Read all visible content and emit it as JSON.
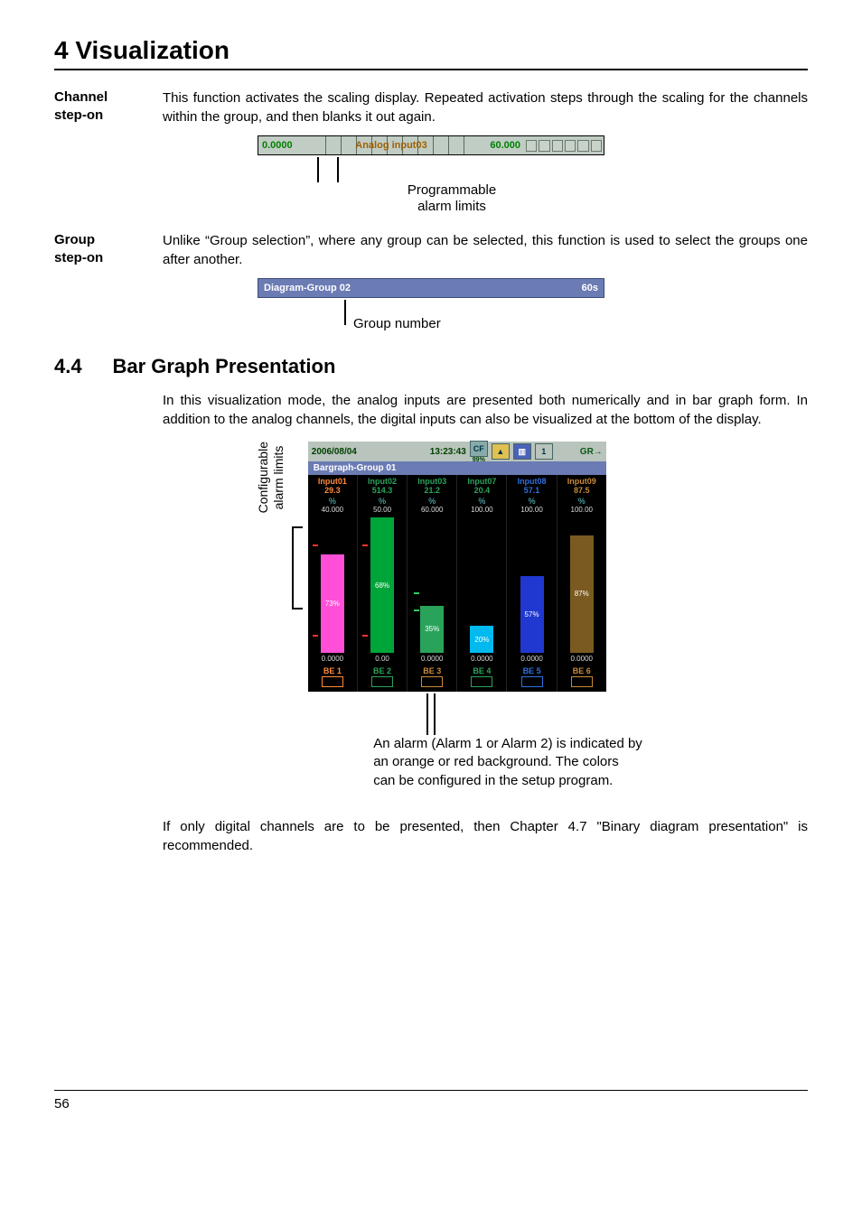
{
  "chapter": {
    "title": "4 Visualization"
  },
  "channel_stepon": {
    "side1": "Channel",
    "side2": "step-on",
    "text": "This function activates the scaling display. Repeated activation steps through the scaling for the channels within the group, and then blanks it out again."
  },
  "scale_fig": {
    "zero": "0.0000",
    "mid": "Analog input03",
    "val": "60.000",
    "label1": "Programmable",
    "label2": "alarm limits"
  },
  "group_stepon": {
    "side1": "Group",
    "side2": "step-on",
    "text": "Unlike “Group selection”, where any group can be selected, this function is used to select the groups one after another."
  },
  "group_fig": {
    "title": "Diagram-Group 02",
    "time": "60s",
    "pointer": "Group number"
  },
  "section": {
    "num": "4.4",
    "title": "Bar Graph Presentation",
    "intro": "In this visualization mode, the analog inputs are presented both numerically and in bar graph form. In addition to the analog channels, the digital inputs can also be visualized at the bottom of the display."
  },
  "shot_vlabel": {
    "l1": "Configurable",
    "l2": "alarm limits"
  },
  "shot": {
    "date": "2006/08/04",
    "time": "13:23:43",
    "cf": "CF",
    "pct": "99%",
    "gr": "GR",
    "title": "Bargraph-Group 01",
    "inputs": [
      {
        "name": "Input01",
        "val": "29.3",
        "unit": "%",
        "max": "40.000",
        "pct": 73,
        "bar_label": "73%",
        "min": "0.0000",
        "color": "#ff4fd8",
        "ncolor": "#ff8a3a"
      },
      {
        "name": "Input02",
        "val": "514.3",
        "unit": "%",
        "max": "50.00",
        "pct": 100,
        "bar_label": "68%",
        "min": "0.00",
        "color": "#00a53a",
        "ncolor": "#2aa35a"
      },
      {
        "name": "Input03",
        "val": "21.2",
        "unit": "%",
        "max": "60.000",
        "pct": 35,
        "bar_label": "35%",
        "min": "0.0000",
        "color": "#2aa35a",
        "ncolor": "#2aa35a"
      },
      {
        "name": "Input07",
        "val": "20.4",
        "unit": "%",
        "max": "100.00",
        "pct": 20,
        "bar_label": "20%",
        "min": "0.0000",
        "color": "#00b9ef",
        "ncolor": "#2aa35a"
      },
      {
        "name": "Input08",
        "val": "57.1",
        "unit": "%",
        "max": "100.00",
        "pct": 57,
        "bar_label": "57%",
        "min": "0.0000",
        "color": "#2038d0",
        "ncolor": "#2f6fe0"
      },
      {
        "name": "Input09",
        "val": "87.5",
        "unit": "%",
        "max": "100.00",
        "pct": 87,
        "bar_label": "87%",
        "min": "0.0000",
        "color": "#7a5a20",
        "ncolor": "#c98a3a"
      }
    ],
    "bes": [
      {
        "name": "BE 1",
        "color": "#ff8a3a"
      },
      {
        "name": "BE 2",
        "color": "#2aa35a"
      },
      {
        "name": "BE 3",
        "color": "#c98a3a"
      },
      {
        "name": "BE 4",
        "color": "#2aa35a"
      },
      {
        "name": "BE 5",
        "color": "#2f6fe0"
      },
      {
        "name": "BE 6",
        "color": "#c98a3a"
      }
    ]
  },
  "annot": {
    "l1": "An alarm (Alarm 1 or Alarm 2) is indicated by",
    "l2": "an orange or red background. The colors",
    "l3": "can be configured in the setup program."
  },
  "closing": "If only digital channels are to be presented, then Chapter 4.7 \"Binary diagram presentation\" is recommended.",
  "page": "56",
  "chart_data": {
    "type": "bar",
    "title": "Bargraph-Group 01",
    "series": [
      {
        "name": "Input01",
        "value": 29.3,
        "pct_of_scale": 73,
        "scale_min": 0.0,
        "scale_max": 40.0,
        "unit": "%"
      },
      {
        "name": "Input02",
        "value": 514.3,
        "pct_of_scale": 68,
        "scale_min": 0.0,
        "scale_max": 50.0,
        "unit": "%"
      },
      {
        "name": "Input03",
        "value": 21.2,
        "pct_of_scale": 35,
        "scale_min": 0.0,
        "scale_max": 60.0,
        "unit": "%"
      },
      {
        "name": "Input07",
        "value": 20.4,
        "pct_of_scale": 20,
        "scale_min": 0.0,
        "scale_max": 100.0,
        "unit": "%"
      },
      {
        "name": "Input08",
        "value": 57.1,
        "pct_of_scale": 57,
        "scale_min": 0.0,
        "scale_max": 100.0,
        "unit": "%"
      },
      {
        "name": "Input09",
        "value": 87.5,
        "pct_of_scale": 87,
        "scale_min": 0.0,
        "scale_max": 100.0,
        "unit": "%"
      }
    ]
  }
}
